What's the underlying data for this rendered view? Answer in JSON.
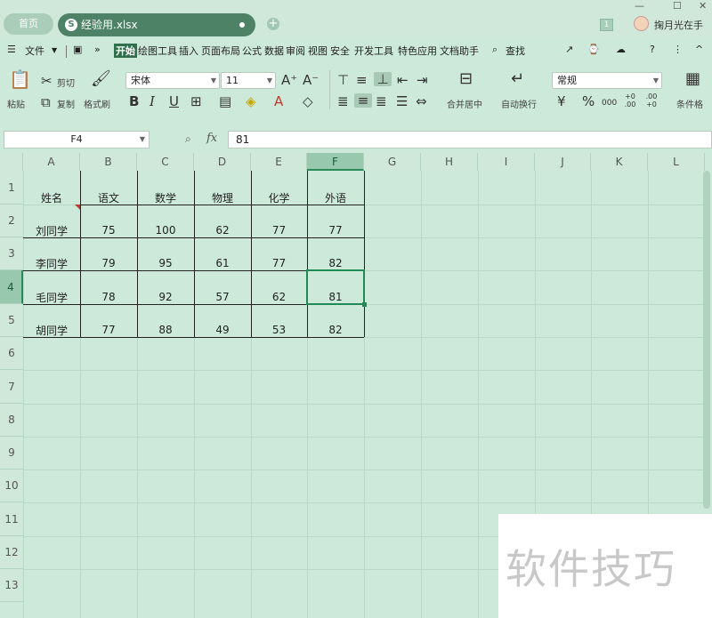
{
  "tabs": {
    "home": "首页",
    "document": "经验用.xlsx",
    "doc_icon": "S"
  },
  "account": {
    "badge": "1",
    "username": "掬月光在手"
  },
  "menu": {
    "file": "文件",
    "expand": "»",
    "items": [
      "开始",
      "绘图工具",
      "插入",
      "页面布局",
      "公式",
      "数据",
      "审阅",
      "视图",
      "安全",
      "开发工具",
      "特色应用",
      "文档助手"
    ],
    "search": "查找"
  },
  "ribbon": {
    "paste": "粘贴",
    "cut": "剪切",
    "copy": "复制",
    "format_painter": "格式刷",
    "font_name": "宋体",
    "font_size": "11",
    "merge_center": "合并居中",
    "wrap_text": "自动换行",
    "number_format": "常规",
    "cond_format": "条件格",
    "percent": "%",
    "thousands": "000",
    "inc_decimal": "+0 .00",
    "dec_decimal": ".00 +0"
  },
  "formula_bar": {
    "cell_ref": "F4",
    "fx": "fx",
    "value": "81"
  },
  "grid": {
    "columns": [
      "A",
      "B",
      "C",
      "D",
      "E",
      "F",
      "G",
      "H",
      "I",
      "J",
      "K",
      "L"
    ],
    "rows": [
      "1",
      "2",
      "3",
      "4",
      "5",
      "6",
      "7",
      "8",
      "9",
      "10",
      "11",
      "12",
      "13"
    ],
    "selected_col": "F",
    "selected_row": "4"
  },
  "table": {
    "headers": [
      "姓名",
      "语文",
      "数学",
      "物理",
      "化学",
      "外语"
    ],
    "rows": [
      [
        "刘同学",
        "75",
        "100",
        "62",
        "77",
        "77"
      ],
      [
        "李同学",
        "79",
        "95",
        "61",
        "77",
        "82"
      ],
      [
        "毛同学",
        "78",
        "92",
        "57",
        "62",
        "81"
      ],
      [
        "胡同学",
        "77",
        "88",
        "49",
        "53",
        "82"
      ]
    ]
  },
  "watermark": "软件技巧",
  "colors": {
    "theme": "#cde9da",
    "accent": "#2f6f4c",
    "selection": "#1f8a55"
  }
}
